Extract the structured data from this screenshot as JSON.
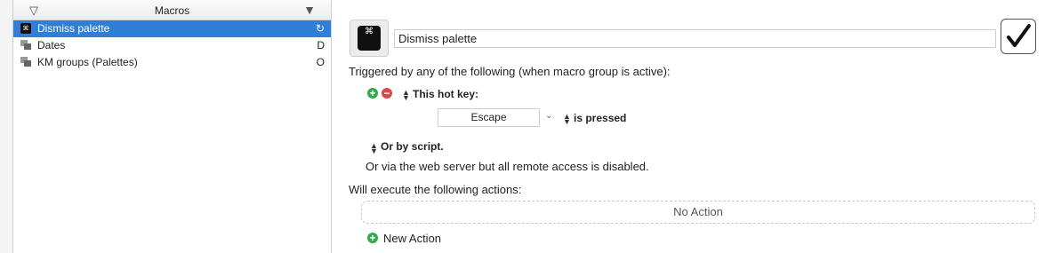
{
  "left_panel": {
    "header_title": "Macros",
    "items": [
      {
        "label": "Dismiss palette",
        "key": "",
        "selected": true,
        "icon": "command-key-icon"
      },
      {
        "label": "Dates",
        "key": "D",
        "selected": false,
        "icon": "macro-group-icon"
      },
      {
        "label": "KM groups (Palettes)",
        "key": "O",
        "selected": false,
        "icon": "macro-group-icon"
      }
    ]
  },
  "editor": {
    "macro_name": "Dismiss palette",
    "icon_glyph": "⌘",
    "triggered_text": "Triggered by any of the following (when macro group is active):",
    "hotkey_label": "This hot key:",
    "hotkey_value": "Escape",
    "is_pressed_label": "is pressed",
    "or_script_label": "Or by script.",
    "web_server_text": "Or via the web server but all remote access is disabled.",
    "will_execute_text": "Will execute the following actions:",
    "no_action_text": "No Action",
    "new_action_label": "New Action"
  },
  "colors": {
    "selection": "#2f7fd8",
    "add_green": "#35a84b",
    "remove_red": "#d64a4a"
  }
}
